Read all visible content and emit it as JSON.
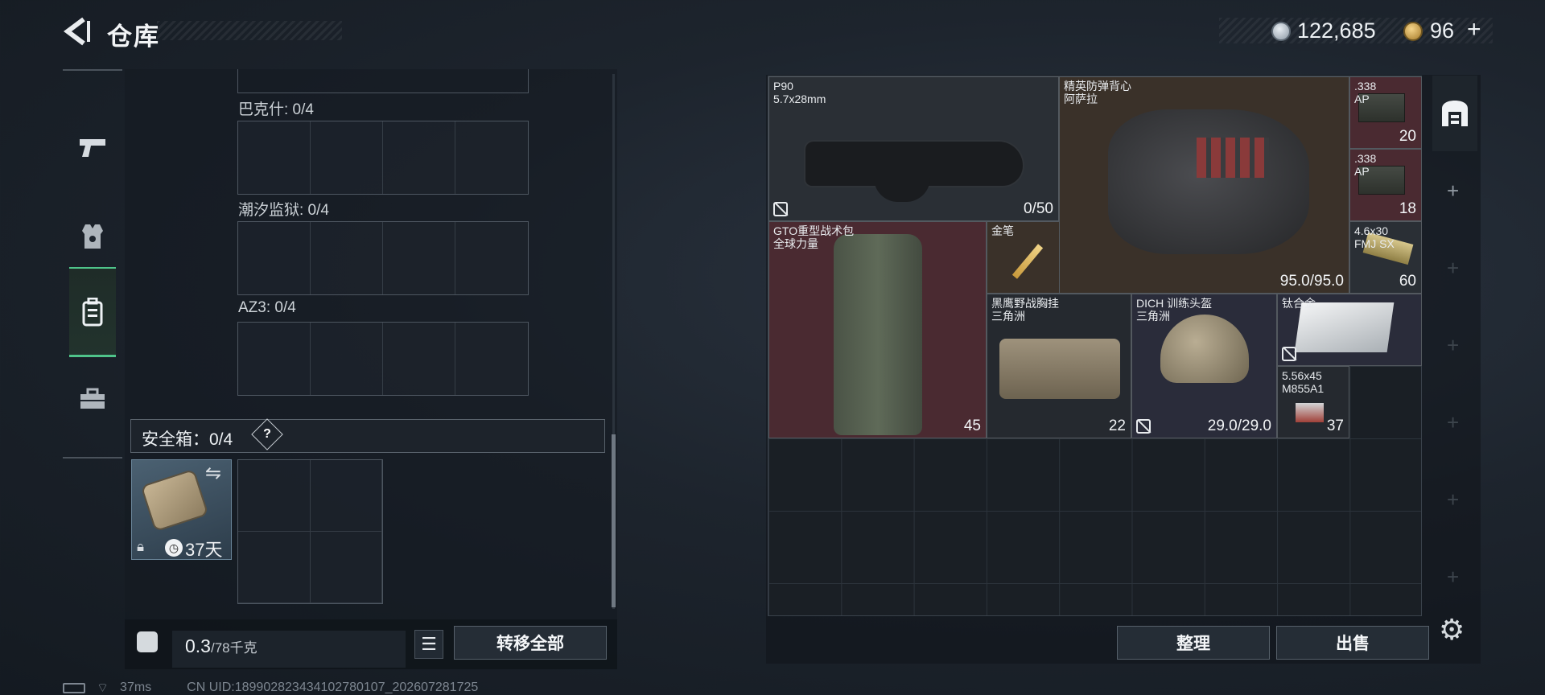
{
  "header": {
    "title": "仓库",
    "back_icon": "back-arrow-icon"
  },
  "currency": {
    "silver": "122,685",
    "gold": "96",
    "gold_plus": "+"
  },
  "nav": {
    "items": [
      {
        "name": "pistol-icon",
        "active": false
      },
      {
        "name": "armor-vest-icon",
        "active": false
      },
      {
        "name": "backpack-icon",
        "active": true
      },
      {
        "name": "toolbox-icon",
        "active": false
      }
    ]
  },
  "containers": [
    {
      "label": "巴克什: 0/4"
    },
    {
      "label": "潮汐监狱: 0/4"
    },
    {
      "label": "AZ3: 0/4"
    }
  ],
  "safe_box": {
    "label": "安全箱：0/4",
    "help": "?",
    "days": "37天"
  },
  "weight": {
    "current": "0.3",
    "max": "/78千克"
  },
  "buttons": {
    "transfer_all": "转移全部",
    "sort": "整理",
    "sell": "出售"
  },
  "status": {
    "ping": "37ms",
    "uid": "CN UID:189902823434102780107_202607281725"
  },
  "stash_items": [
    {
      "id": "p90",
      "name": "P90\n5.7x28mm",
      "qty": "0/50",
      "color": "gray"
    },
    {
      "id": "vest",
      "name": "精英防弹背心\n阿萨拉",
      "qty": "95.0/95.0",
      "color": "brown"
    },
    {
      "id": "ap338a",
      "name": ".338\nAP",
      "qty": "20",
      "color": "red"
    },
    {
      "id": "ap338b",
      "name": ".338\nAP",
      "qty": "18",
      "color": "red"
    },
    {
      "id": "backpack",
      "name": "GTO重型战术包\n全球力量",
      "qty": "45",
      "color": "red"
    },
    {
      "id": "pen",
      "name": "金笔",
      "qty": "",
      "color": "brown"
    },
    {
      "id": "fmj",
      "name": "4.6x30\nFMJ SX",
      "qty": "60",
      "color": "gray"
    },
    {
      "id": "rig",
      "name": "黑鹰野战胸挂\n三角洲",
      "qty": "22",
      "color": "dark"
    },
    {
      "id": "helmet",
      "name": "DICH 训练头盔\n三角洲",
      "qty": "29.0/29.0",
      "color": "blue"
    },
    {
      "id": "alloy",
      "name": "钛合金",
      "qty": "",
      "color": "blue"
    },
    {
      "id": "m855",
      "name": "5.56x45\nM855A1",
      "qty": "37",
      "color": "dark"
    }
  ]
}
